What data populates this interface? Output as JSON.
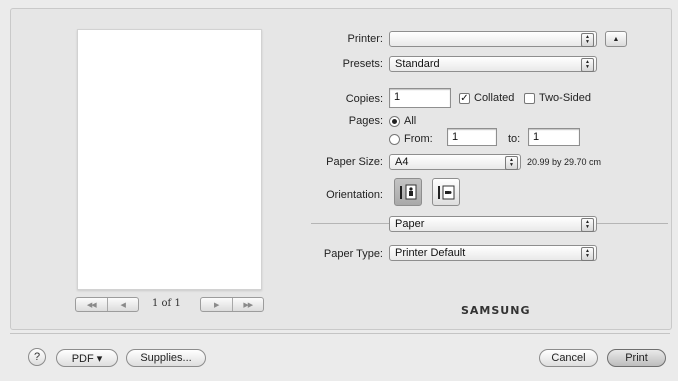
{
  "preview": {
    "page_count_text": "1 of 1",
    "nav_first_icon": "first-page-icon",
    "nav_prev_icon": "prev-page-icon",
    "nav_next_icon": "next-page-icon",
    "nav_last_icon": "last-page-icon"
  },
  "printer": {
    "label": "Printer:",
    "value": ""
  },
  "presets": {
    "label": "Presets:",
    "value": "Standard"
  },
  "copies": {
    "label": "Copies:",
    "value": "1",
    "collated_label": "Collated",
    "collated_checked": true,
    "two_sided_label": "Two-Sided",
    "two_sided_checked": false
  },
  "pages": {
    "label": "Pages:",
    "all_label": "All",
    "from_label": "From:",
    "from_value": "1",
    "to_label": "to:",
    "to_value": "1",
    "selected": "All"
  },
  "paper_size": {
    "label": "Paper Size:",
    "value": "A4",
    "dimensions": "20.99 by 29.70 cm"
  },
  "orientation": {
    "label": "Orientation:",
    "selected": "portrait"
  },
  "section_popup": {
    "value": "Paper"
  },
  "paper_type": {
    "label": "Paper Type:",
    "value": "Printer Default"
  },
  "brand": "SAMSUNG",
  "footer": {
    "help_label": "?",
    "pdf_label": "PDF ▾",
    "supplies_label": "Supplies...",
    "cancel_label": "Cancel",
    "print_label": "Print"
  }
}
